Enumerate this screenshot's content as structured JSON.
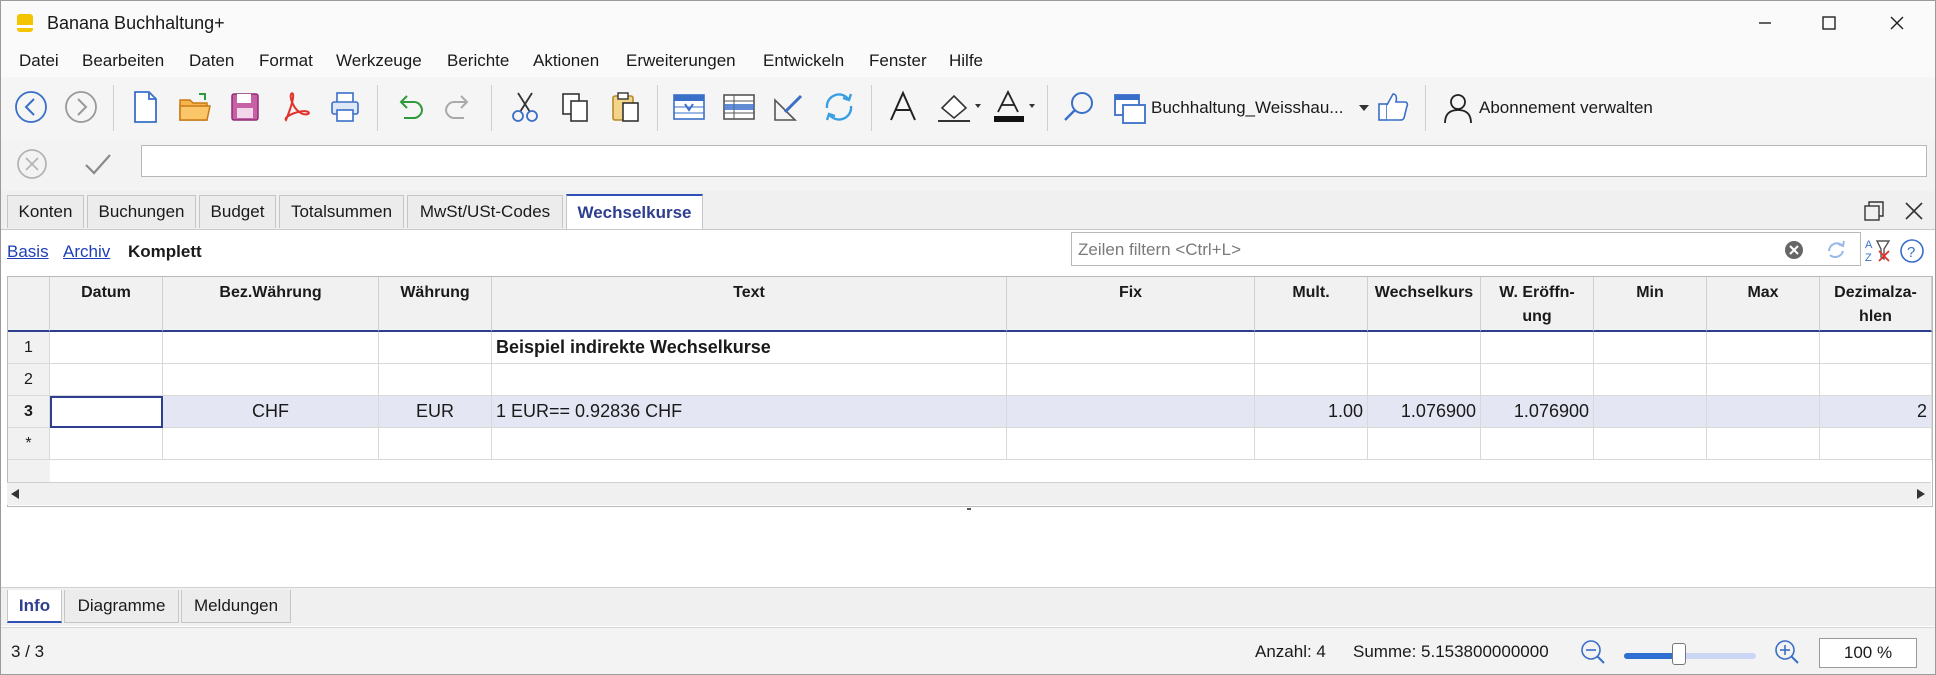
{
  "app": {
    "title": "Banana Buchhaltung+"
  },
  "menu": [
    "Datei",
    "Bearbeiten",
    "Daten",
    "Format",
    "Werkzeuge",
    "Berichte",
    "Aktionen",
    "Erweiterungen",
    "Entwickeln",
    "Fenster",
    "Hilfe"
  ],
  "toolbar": {
    "file_selector": "Buchhaltung_Weisshau...",
    "subscription": "Abonnement verwalten"
  },
  "tabs": [
    "Konten",
    "Buchungen",
    "Budget",
    "Totalsummen",
    "MwSt/USt-Codes",
    "Wechselkurse"
  ],
  "active_tab": "Wechselkurse",
  "views": {
    "basis": "Basis",
    "archiv": "Archiv",
    "komplett": "Komplett"
  },
  "filter": {
    "placeholder": "Zeilen filtern <Ctrl+L>"
  },
  "table": {
    "columns": [
      "Datum",
      "Bez.Währung",
      "Währung",
      "Text",
      "Fix",
      "Mult.",
      "Wechselkurs",
      "W. Eröffn-\nung",
      "Min",
      "Max",
      "Dezimalza-\nhlen"
    ],
    "rows": [
      {
        "num": "1",
        "datum": "",
        "bez": "",
        "waehrung": "",
        "text": "Beispiel indirekte Wechselkurse",
        "fix": "",
        "mult": "",
        "kurs": "",
        "eroeffnung": "",
        "min": "",
        "max": "",
        "dez": ""
      },
      {
        "num": "2",
        "datum": "",
        "bez": "",
        "waehrung": "",
        "text": "",
        "fix": "",
        "mult": "",
        "kurs": "",
        "eroeffnung": "",
        "min": "",
        "max": "",
        "dez": ""
      },
      {
        "num": "3",
        "datum": "",
        "bez": "CHF",
        "waehrung": "EUR",
        "text": "1 EUR== 0.92836 CHF",
        "fix": "",
        "mult": "1.00",
        "kurs": "1.076900",
        "eroeffnung": "1.076900",
        "min": "",
        "max": "",
        "dez": "2"
      },
      {
        "num": "*",
        "datum": "",
        "bez": "",
        "waehrung": "",
        "text": "",
        "fix": "",
        "mult": "",
        "kurs": "",
        "eroeffnung": "",
        "min": "",
        "max": "",
        "dez": ""
      }
    ]
  },
  "bottom_tabs": [
    "Info",
    "Diagramme",
    "Meldungen"
  ],
  "status": {
    "position": "3 / 3",
    "count": "Anzahl: 4",
    "sum": "Summe: 5.153800000000",
    "zoom": "100 %",
    "zoom_level": 0.42
  },
  "colors": {
    "accent": "#2e3f8f",
    "selection": "#e4e7f3",
    "logo": "#f5c400"
  }
}
